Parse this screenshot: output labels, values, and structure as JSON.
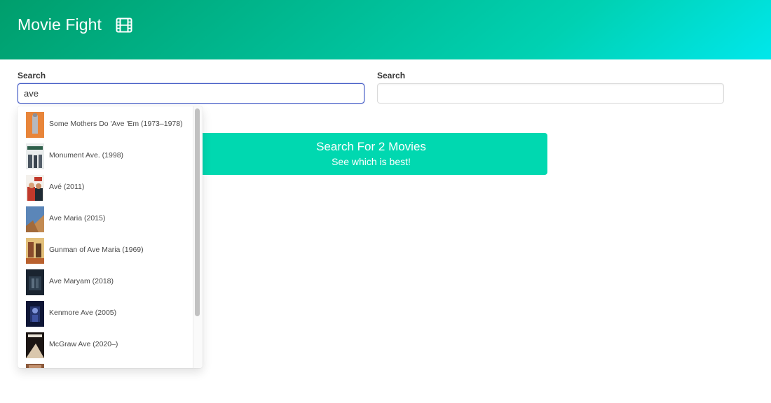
{
  "header": {
    "title": "Movie Fight",
    "icon": "film-icon"
  },
  "left_search": {
    "label": "Search",
    "value": "ave",
    "placeholder": ""
  },
  "right_search": {
    "label": "Search",
    "value": "",
    "placeholder": ""
  },
  "cta": {
    "title": "Search For 2 Movies",
    "subtitle": "See which is best!"
  },
  "colors": {
    "header_start": "#009e6c",
    "header_end": "#00e7eb",
    "accent": "#00d8b0",
    "focus": "#485fc7"
  },
  "results": [
    {
      "title": "Some Mothers Do 'Ave 'Em (1973–1978)"
    },
    {
      "title": "Monument Ave. (1998)"
    },
    {
      "title": "Avé (2011)"
    },
    {
      "title": "Ave Maria (2015)"
    },
    {
      "title": "Gunman of Ave Maria (1969)"
    },
    {
      "title": "Ave Maryam (2018)"
    },
    {
      "title": "Kenmore Ave (2005)"
    },
    {
      "title": "McGraw Ave (2020–)"
    }
  ]
}
